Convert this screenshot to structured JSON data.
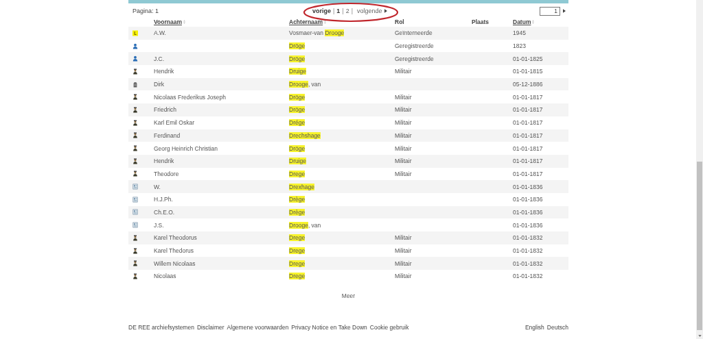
{
  "header": {
    "page_label": "Pagina: 1",
    "pager": {
      "previous": "vorige",
      "pages": [
        {
          "label": "1",
          "selected": true
        },
        {
          "label": "2",
          "selected": false
        }
      ],
      "next": "volgende",
      "separator": "|",
      "annotated": true
    },
    "page_input": {
      "value": "1"
    }
  },
  "table": {
    "columns": [
      {
        "label": "Voornaam",
        "sortable": true
      },
      {
        "label": "Achternaam",
        "sortable": true
      },
      {
        "label": "Rol",
        "sortable": false
      },
      {
        "label": "Plaats",
        "sortable": false
      },
      {
        "label": "Datum",
        "sortable": true
      }
    ],
    "rows": [
      {
        "kind": "tag",
        "first_name": "A.W.",
        "surname_before": "Vosmaer-van ",
        "surname_match": "Drooge",
        "role": "Geïnterneerde",
        "date": "1945"
      },
      {
        "kind": "person",
        "surname_match": "Dröge",
        "role": "Geregistreerde",
        "date": "1823"
      },
      {
        "kind": "person",
        "first_name": "J.C.",
        "surname_match": "Dröge",
        "role": "Geregistreerde",
        "date": "01-01-1825"
      },
      {
        "kind": "soldier",
        "first_name": "Hendrik",
        "surname_match": "Druige",
        "role": "Militair",
        "date": "01-01-1815"
      },
      {
        "kind": "grave",
        "first_name": "Dirk",
        "surname_match": "Drooge",
        "surname_after": ", van",
        "date": "05-12-1886"
      },
      {
        "kind": "soldier",
        "first_name": "Nicolaas Frederikus Joseph",
        "surname_match": "Dröge",
        "role": "Militair",
        "date": "01-01-1817"
      },
      {
        "kind": "soldier",
        "first_name": "Friedrich",
        "surname_match": "Dröge",
        "role": "Militair",
        "date": "01-01-1817"
      },
      {
        "kind": "soldier",
        "first_name": "Karl Emil Oskar",
        "surname_match": "Drége",
        "role": "Militair",
        "date": "01-01-1817"
      },
      {
        "kind": "soldier",
        "first_name": "Ferdinand",
        "surname_match": "Drechshage",
        "role": "Militair",
        "date": "01-01-1817"
      },
      {
        "kind": "soldier",
        "first_name": "Georg Heinrich Christian",
        "surname_match": "Dröge",
        "role": "Militair",
        "date": "01-01-1817"
      },
      {
        "kind": "soldier",
        "first_name": "Hendrik",
        "surname_match": "Druige",
        "role": "Militair",
        "date": "01-01-1817"
      },
      {
        "kind": "soldier",
        "first_name": "Theodore",
        "surname_match": "Drege",
        "role": "Militair",
        "date": "01-01-1817"
      },
      {
        "kind": "document",
        "first_name": "W.",
        "surname_match": "Drexhage",
        "date": "01-01-1836"
      },
      {
        "kind": "document",
        "first_name": "H.J.Ph.",
        "surname_match": "Drège",
        "date": "01-01-1836"
      },
      {
        "kind": "document",
        "first_name": "Ch.E.O.",
        "surname_match": "Drège",
        "date": "01-01-1836"
      },
      {
        "kind": "document",
        "first_name": "J.S.",
        "surname_match": "Drooge",
        "surname_after": ", van",
        "date": "01-01-1836"
      },
      {
        "kind": "soldier",
        "first_name": "Karel Theodorus",
        "surname_match": "Drege",
        "role": "Militair",
        "date": "01-01-1832"
      },
      {
        "kind": "soldier",
        "first_name": "Karel Thedorus",
        "surname_match": "Drege",
        "role": "Militair",
        "date": "01-01-1832"
      },
      {
        "kind": "soldier",
        "first_name": "Willem Nicolaas",
        "surname_match": "Drege",
        "role": "Militair",
        "date": "01-01-1832"
      },
      {
        "kind": "soldier",
        "first_name": "Nicolaas",
        "surname_match": "Drege",
        "role": "Militair",
        "date": "01-01-1832"
      }
    ]
  },
  "more_link": "Meer",
  "footer": {
    "links": [
      "DE REE archiefsystemen",
      "Disclaimer",
      "Algemene voorwaarden",
      "Privacy Notice en Take Down",
      "Cookie gebruik"
    ],
    "languages": [
      "English",
      "Deutsch"
    ]
  }
}
